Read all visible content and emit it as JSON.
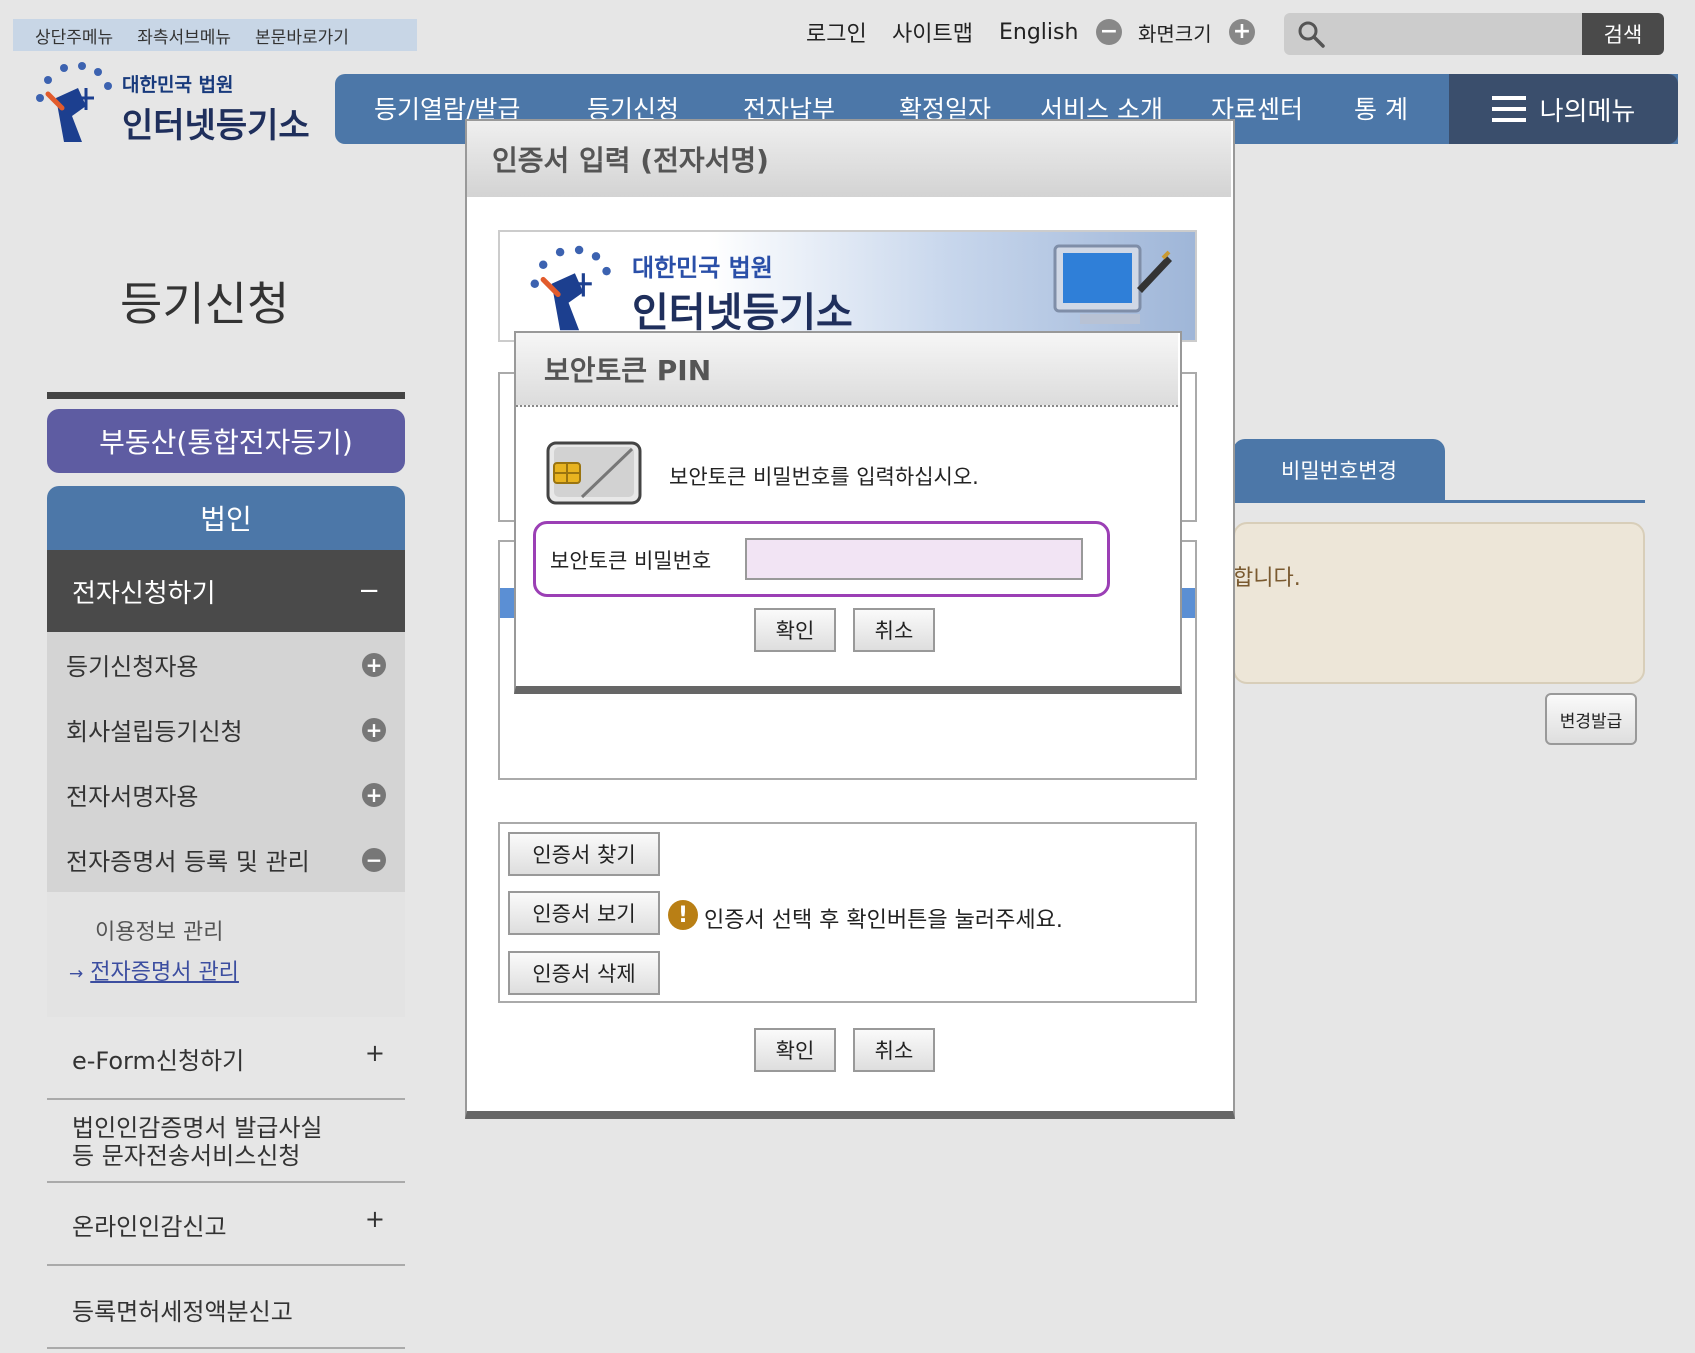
{
  "skip_links": [
    "상단주메뉴",
    "좌측서브메뉴",
    "본문바로가기"
  ],
  "util": {
    "login": "로그인",
    "sitemap": "사이트맵",
    "english": "English",
    "screen_size": "화면크기",
    "search_button": "검색"
  },
  "logo": {
    "line1": "대한민국 법원",
    "line2": "인터넷등기소"
  },
  "nav": [
    "등기열람/발급",
    "등기신청",
    "전자납부",
    "확정일자",
    "서비스 소개",
    "자료센터",
    "통 계"
  ],
  "my_menu": "나의메뉴",
  "sidebar": {
    "title": "등기신청",
    "pill_realestate": "부동산(통합전자등기)",
    "pill_corp": "법인",
    "section_open": "전자신청하기",
    "section_open_toggle": "−",
    "items": [
      "등기신청자용",
      "회사설립등기신청",
      "전자서명자용",
      "전자증명서 등록 및 관리"
    ],
    "sub_items": [
      "이용정보 관리",
      "전자증명서 관리"
    ],
    "sub_arrow": "→",
    "menus": [
      {
        "label": "e-Form신청하기",
        "toggle": "+"
      },
      {
        "label": "법인인감증명서 발급사실\n등 문자전송서비스신청",
        "toggle": ""
      },
      {
        "label": "온라인인감신고",
        "toggle": "+"
      },
      {
        "label": "등록면허세정액분신고",
        "toggle": ""
      }
    ]
  },
  "right_panel": {
    "tab_label": "비밀번호변경",
    "notice_fragment": "합니다.",
    "change_issue_button": "변경발급"
  },
  "cert_dialog": {
    "title": "인증서 입력 (전자서명)",
    "find_button": "인증서 찾기",
    "view_button": "인증서 보기",
    "delete_button": "인증서 삭제",
    "notice": "인증서 선택 후 확인버튼을 눌러주세요.",
    "ok_button": "확인",
    "cancel_button": "취소"
  },
  "pin_dialog": {
    "title": "보안토큰 PIN",
    "message": "보안토큰 비밀번호를 입력하십시오.",
    "field_label": "보안토큰 비밀번호",
    "field_value": "",
    "ok_button": "확인",
    "cancel_button": "취소"
  },
  "colors": {
    "nav_blue": "#4c77a8",
    "pill_purple": "#5e5ca2",
    "highlight_border": "#9b3fb5",
    "field_fill": "#f2e4f4"
  }
}
